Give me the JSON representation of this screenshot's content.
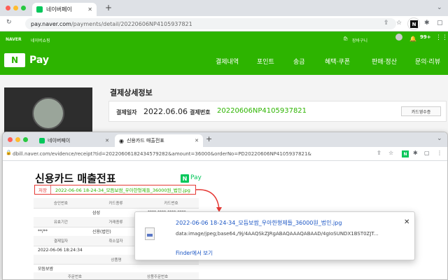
{
  "browser": {
    "tab_title": "네이버페이",
    "url_host": "pay.naver.com",
    "url_path": "/payments/detail/20220606NP4105937821",
    "profile_initial": "N",
    "extensions_icon": "puzzle-icon"
  },
  "naverpay": {
    "top_links": [
      "NAVER",
      "네이버쇼핑"
    ],
    "cart": "장바구니",
    "notif_count": "99+",
    "logo_letter": "N",
    "logo_text": "Pay",
    "menu": [
      "결제내역",
      "포인트",
      "송금",
      "혜택·쿠폰",
      "판매·정산",
      "문의·리뷰"
    ],
    "detail_title": "결제상세정보",
    "pay_date_label": "결제일자",
    "pay_date": "2022.06.06",
    "pay_no_label": "결제번호",
    "pay_no": "20220606NP4105937821",
    "card_receipt_button": "카드영수증"
  },
  "window2": {
    "tab1_title": "네이버페이",
    "tab2_title": "신용카드 매출전표",
    "url": "dbill.naver.com/evidence/receipt?tid=20220606182434579282&amount=36000&orderNo=PD20220606NP4105937821&",
    "receipt_title": "신용카드 매출전표",
    "receipt_logo_letter": "N",
    "receipt_logo_text": "Pay",
    "save_label": "저장",
    "save_filename": "2022-06-06 18-24-34_모듬보쌈_우아한형제들_36000원_법인.jpg",
    "table": {
      "r1": [
        "승인번호",
        "카드종류",
        "카드번호"
      ],
      "r2": [
        "",
        "삼성",
        "****-****-****-****"
      ],
      "r3": [
        "유효기간",
        "거래종류",
        "할부"
      ],
      "r4": [
        "**/**",
        "신용(법인)",
        ""
      ],
      "r5": [
        "결제일자",
        "취소일자",
        ""
      ],
      "r6": [
        "2022-06-06 18:24:34",
        "",
        ""
      ],
      "r7": [
        "",
        "상품명",
        ""
      ],
      "r8": [
        "모듬보쌈",
        "",
        ""
      ],
      "r9": [
        "주문번호",
        "",
        "상품주문번호"
      ]
    }
  },
  "download": {
    "filename": "2022-06-06 18-24-34_모듬보쌈_우아한형제들_36000원_법인.jpg",
    "data_url": "data:image/jpeg;base64,/9j/4AAQSkZJRgABAQAAAQABAAD/4gIoSUNDX1BST0ZJT...",
    "finder_link": "Finder에서 보기"
  }
}
